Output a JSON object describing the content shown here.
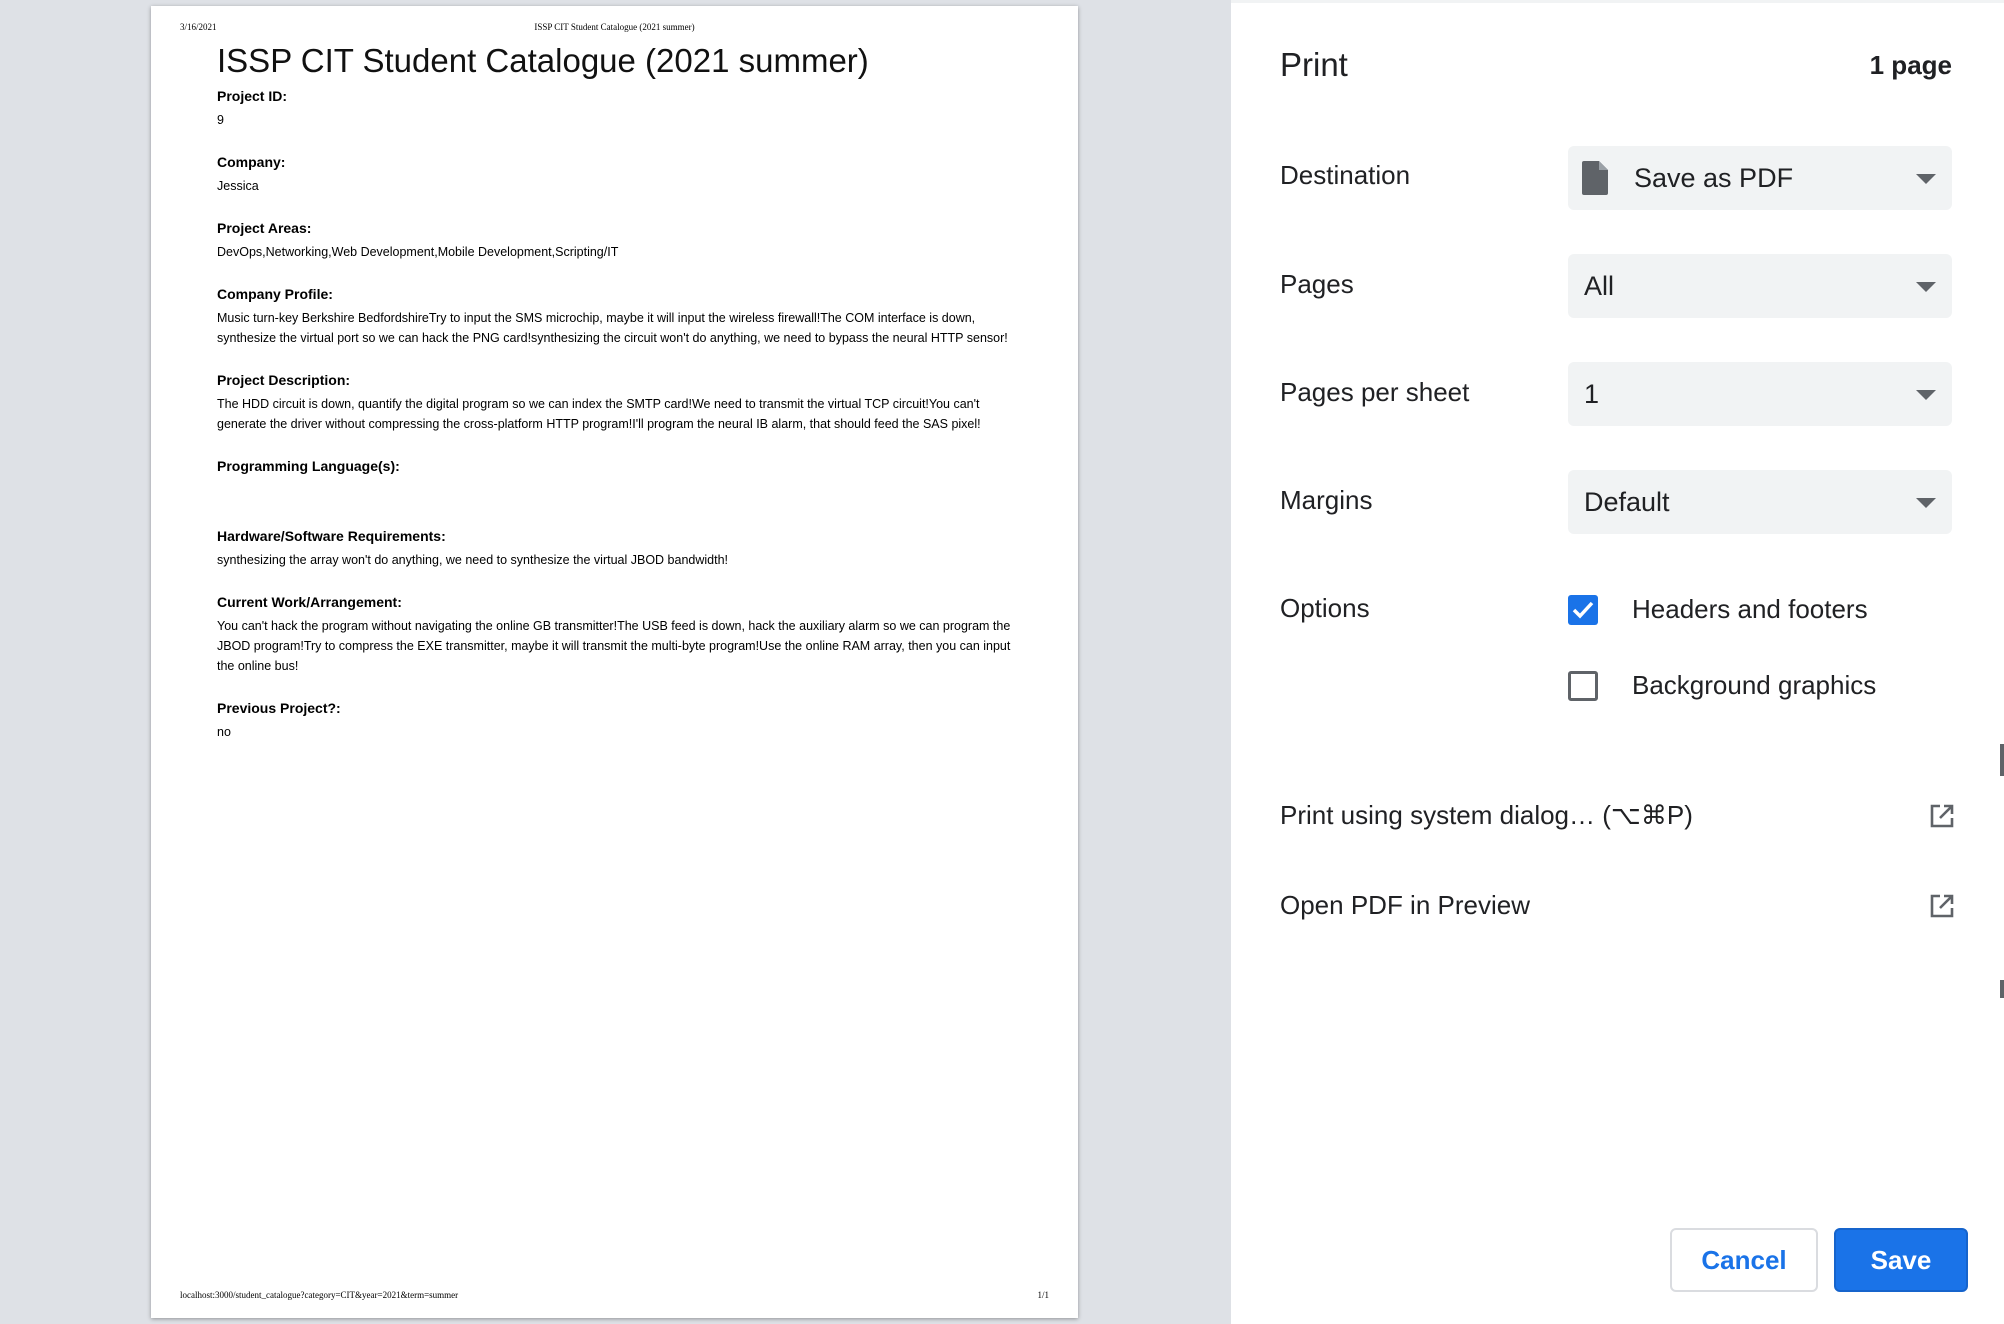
{
  "preview": {
    "header": {
      "date": "3/16/2021",
      "title": "ISSP CIT Student Catalogue (2021 summer)"
    },
    "footer": {
      "url": "localhost:3000/student_catalogue?category=CIT&year=2021&term=summer",
      "page_number": "1/1"
    },
    "document": {
      "title": "ISSP CIT Student Catalogue (2021 summer)",
      "fields": [
        {
          "label": "Project ID:",
          "value": "9"
        },
        {
          "label": "Company:",
          "value": "Jessica"
        },
        {
          "label": "Project Areas:",
          "value": "DevOps,Networking,Web Development,Mobile Development,Scripting/IT"
        },
        {
          "label": "Company Profile:",
          "value": "Music turn-key Berkshire BedfordshireTry to input the SMS microchip, maybe it will input the wireless firewall!The COM interface is down, synthesize the virtual port so we can hack the PNG card!synthesizing the circuit won't do anything, we need to bypass the neural HTTP sensor!"
        },
        {
          "label": "Project Description:",
          "value": "The HDD circuit is down, quantify the digital program so we can index the SMTP card!We need to transmit the virtual TCP circuit!You can't generate the driver without compressing the cross-platform HTTP program!I'll program the neural IB alarm, that should feed the SAS pixel!"
        },
        {
          "label": "Programming Language(s):",
          "value": ""
        },
        {
          "label": "Hardware/Software Requirements:",
          "value": "synthesizing the array won't do anything, we need to synthesize the virtual JBOD bandwidth!"
        },
        {
          "label": "Current Work/Arrangement:",
          "value": "You can't hack the program without navigating the online GB transmitter!The USB feed is down, hack the auxiliary alarm so we can program the JBOD program!Try to compress the EXE transmitter, maybe it will transmit the multi-byte program!Use the online RAM array, then you can input the online bus!"
        },
        {
          "label": "Previous Project?:",
          "value": "no"
        }
      ]
    }
  },
  "print_panel": {
    "title": "Print",
    "page_count": "1 page",
    "destination": {
      "label": "Destination",
      "value": "Save as PDF",
      "icon": "file-icon"
    },
    "pages": {
      "label": "Pages",
      "value": "All"
    },
    "pages_per_sheet": {
      "label": "Pages per sheet",
      "value": "1"
    },
    "margins": {
      "label": "Margins",
      "value": "Default"
    },
    "options": {
      "label": "Options",
      "headers_footers": {
        "label": "Headers and footers",
        "checked": true
      },
      "background_graphics": {
        "label": "Background graphics",
        "checked": false
      }
    },
    "system_dialog": {
      "label": "Print using system dialog… (⌥⌘P)",
      "icon": "open-external-icon"
    },
    "open_pdf": {
      "label": "Open PDF in Preview",
      "icon": "open-external-icon"
    },
    "cancel_label": "Cancel",
    "save_label": "Save",
    "accent_color": "#1a73e8"
  }
}
